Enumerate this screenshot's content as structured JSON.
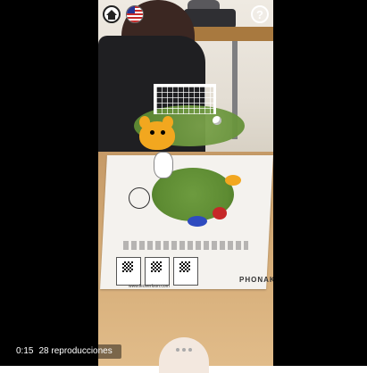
{
  "video": {
    "time": "0:15",
    "views": "28 reproducciones"
  },
  "ar_app": {
    "help_label": "?",
    "brand_text": "PHONAK",
    "site_text": "www.leoverloon.com"
  },
  "colors": {
    "field_green": "#5d8b32",
    "creature_orange": "#f2a71f",
    "background_black": "#000000"
  }
}
